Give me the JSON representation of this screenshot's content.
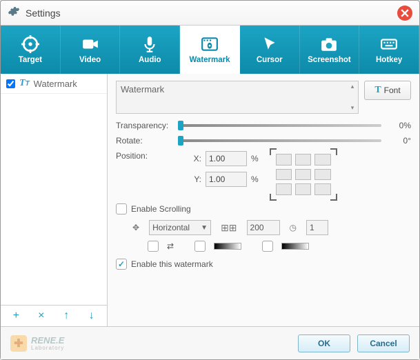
{
  "window": {
    "title": "Settings"
  },
  "tabs": [
    {
      "label": "Target"
    },
    {
      "label": "Video"
    },
    {
      "label": "Audio"
    },
    {
      "label": "Watermark"
    },
    {
      "label": "Cursor"
    },
    {
      "label": "Screenshot"
    },
    {
      "label": "Hotkey"
    }
  ],
  "sidebar": {
    "items": [
      {
        "label": "Watermark",
        "checked": true
      }
    ]
  },
  "panel": {
    "watermark_text": "Watermark",
    "font_button": "Font",
    "labels": {
      "transparency": "Transparency:",
      "rotate": "Rotate:",
      "position": "Position:",
      "x": "X:",
      "y": "Y:",
      "enable_scrolling": "Enable Scrolling",
      "enable_watermark": "Enable this watermark",
      "percent": "%"
    },
    "values": {
      "transparency": "0%",
      "rotate": "0°",
      "x": "1.00",
      "y": "1.00",
      "scroll_dir": "Horizontal",
      "scroll_width": "200",
      "scroll_time": "1"
    },
    "checks": {
      "enable_scrolling": false,
      "enable_watermark": true
    }
  },
  "footer": {
    "ok": "OK",
    "cancel": "Cancel",
    "brand": "RENE.E",
    "brand_sub": "Laboratory"
  }
}
